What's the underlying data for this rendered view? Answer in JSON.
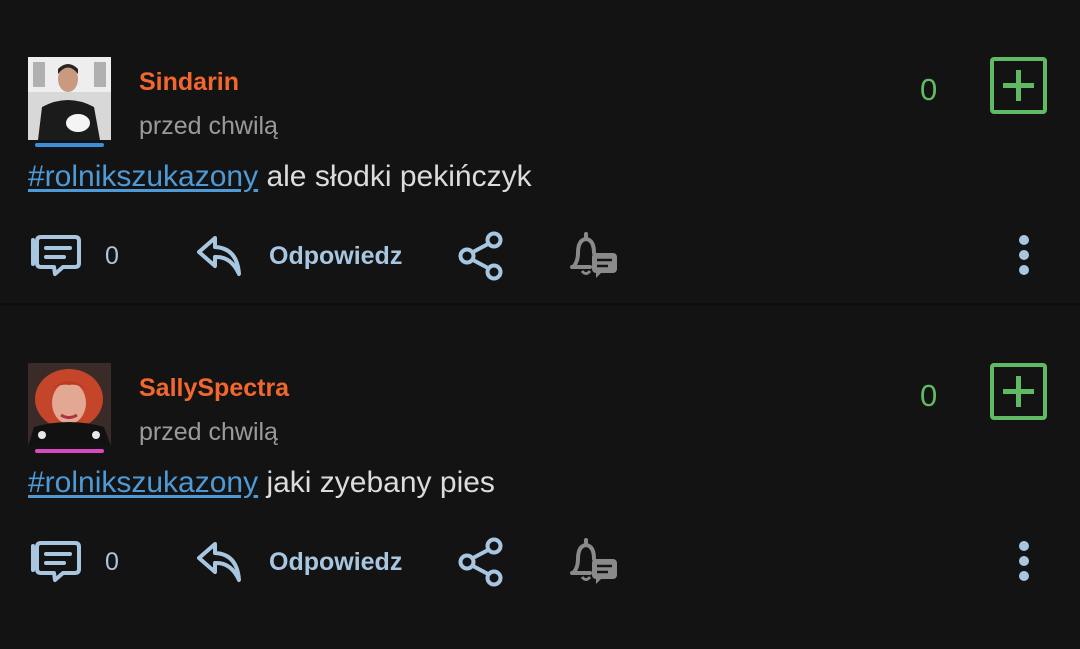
{
  "posts": [
    {
      "author": "Sindarin",
      "time": "przed chwilą",
      "tag": "#rolnikszukazony",
      "text": " ale słodki pekińczyk",
      "score": "0",
      "comment_count": "0",
      "reply_label": "Odpowiedz",
      "underline_color": "#3c8ed8"
    },
    {
      "author": "SallySpectra",
      "time": "przed chwilą",
      "tag": "#rolnikszukazony",
      "text": " jaki zyebany pies",
      "score": "0",
      "comment_count": "0",
      "reply_label": "Odpowiedz",
      "underline_color": "#d94ac2"
    }
  ],
  "colors": {
    "background": "#131313",
    "author": "#f2672d",
    "tag": "#4e9ad6",
    "score": "#5fba63",
    "action": "#a9c6e0"
  },
  "icons": [
    "comments-icon",
    "reply-icon",
    "share-icon",
    "notify-icon",
    "more-icon",
    "upvote-plus-icon"
  ]
}
